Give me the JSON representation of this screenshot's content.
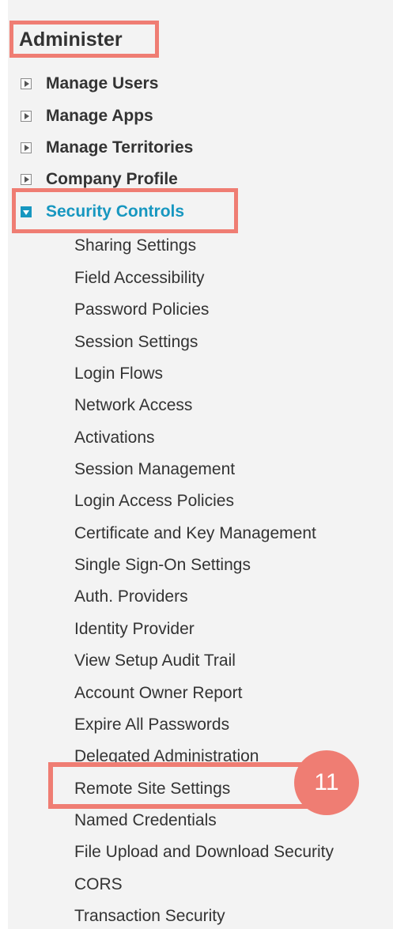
{
  "header": {
    "title": "Administer"
  },
  "tree": [
    {
      "label": "Manage Users"
    },
    {
      "label": "Manage Apps"
    },
    {
      "label": "Manage Territories"
    },
    {
      "label": "Company Profile"
    },
    {
      "label": "Security Controls"
    }
  ],
  "security_controls": {
    "items": [
      "Sharing Settings",
      "Field Accessibility",
      "Password Policies",
      "Session Settings",
      "Login Flows",
      "Network Access",
      "Activations",
      "Session Management",
      "Login Access Policies",
      "Certificate and Key Management",
      "Single Sign-On Settings",
      "Auth. Providers",
      "Identity Provider",
      "View Setup Audit Trail",
      "Account Owner Report",
      "Expire All Passwords",
      "Delegated Administration",
      "Remote Site Settings",
      "Named Credentials",
      "File Upload and Download Security",
      "CORS",
      "Transaction Security"
    ]
  },
  "annotation": {
    "step": "11"
  },
  "colors": {
    "highlight": "#ef7d73",
    "active": "#1797c0",
    "text": "#333333",
    "panel": "#f3f3f3"
  }
}
